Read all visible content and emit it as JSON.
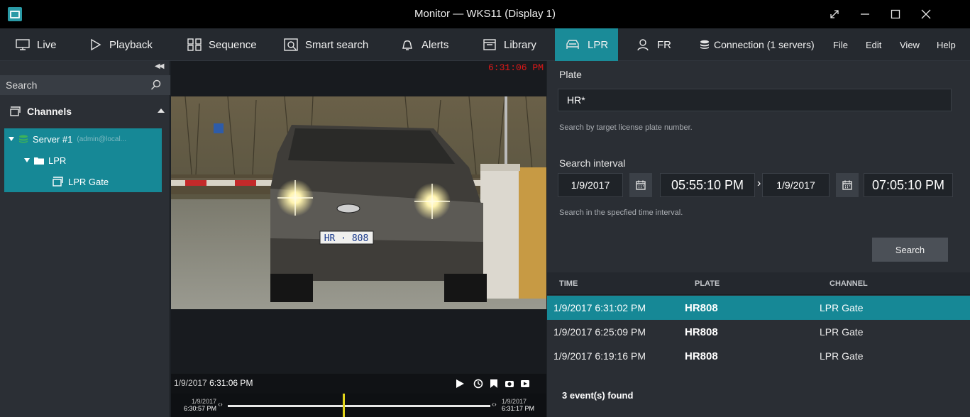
{
  "window": {
    "title": "Monitor — WKS11 (Display 1)"
  },
  "menubar": {
    "tabs": [
      {
        "label": "Live",
        "icon": "monitor-icon"
      },
      {
        "label": "Playback",
        "icon": "play-icon"
      },
      {
        "label": "Sequence",
        "icon": "sequence-icon"
      },
      {
        "label": "Smart search",
        "icon": "smart-search-icon"
      },
      {
        "label": "Alerts",
        "icon": "bell-icon"
      },
      {
        "label": "Library",
        "icon": "library-icon"
      },
      {
        "label": "LPR",
        "icon": "car-icon",
        "active": true
      },
      {
        "label": "FR",
        "icon": "face-icon"
      }
    ],
    "connection": "Connection (1 servers)",
    "menus": [
      "File",
      "Edit",
      "View",
      "Help"
    ]
  },
  "sidebar": {
    "search_placeholder": "Search",
    "channels_title": "Channels",
    "tree": {
      "server": "Server #1",
      "server_sub": "(admin@local...",
      "folder": "LPR",
      "channel": "LPR Gate"
    }
  },
  "video": {
    "timestamp": "6:31:06 PM",
    "plate_text": "HR · 808",
    "playbar_date": "1/9/2017",
    "playbar_time": "6:31:06 PM",
    "timeline_start_date": "1/9/2017",
    "timeline_start_time": "6:30:57 PM",
    "timeline_end_date": "1/9/2017",
    "timeline_end_time": "6:31:17 PM"
  },
  "lpr": {
    "plate_label": "Plate",
    "plate_value": "HR*",
    "plate_hint": "Search by target license plate number.",
    "interval_label": "Search interval",
    "from_date": "1/9/2017",
    "from_time": "05:55:10 PM",
    "separator": "›",
    "to_date": "1/9/2017",
    "to_time": "07:05:10 PM",
    "interval_hint": "Search in the specfied time interval.",
    "search_button": "Search",
    "columns": {
      "time": "TIME",
      "plate": "PLATE",
      "channel": "CHANNEL"
    },
    "results": [
      {
        "time": "1/9/2017 6:31:02 PM",
        "plate": "HR808",
        "channel": "LPR Gate",
        "selected": true
      },
      {
        "time": "1/9/2017 6:25:09 PM",
        "plate": "HR808",
        "channel": "LPR Gate"
      },
      {
        "time": "1/9/2017 6:19:16 PM",
        "plate": "HR808",
        "channel": "LPR Gate"
      }
    ],
    "events_found": "3 event(s) found"
  },
  "colors": {
    "accent": "#168896",
    "timestamp_red": "#e01818",
    "timeline_cursor": "#e2d41a"
  }
}
